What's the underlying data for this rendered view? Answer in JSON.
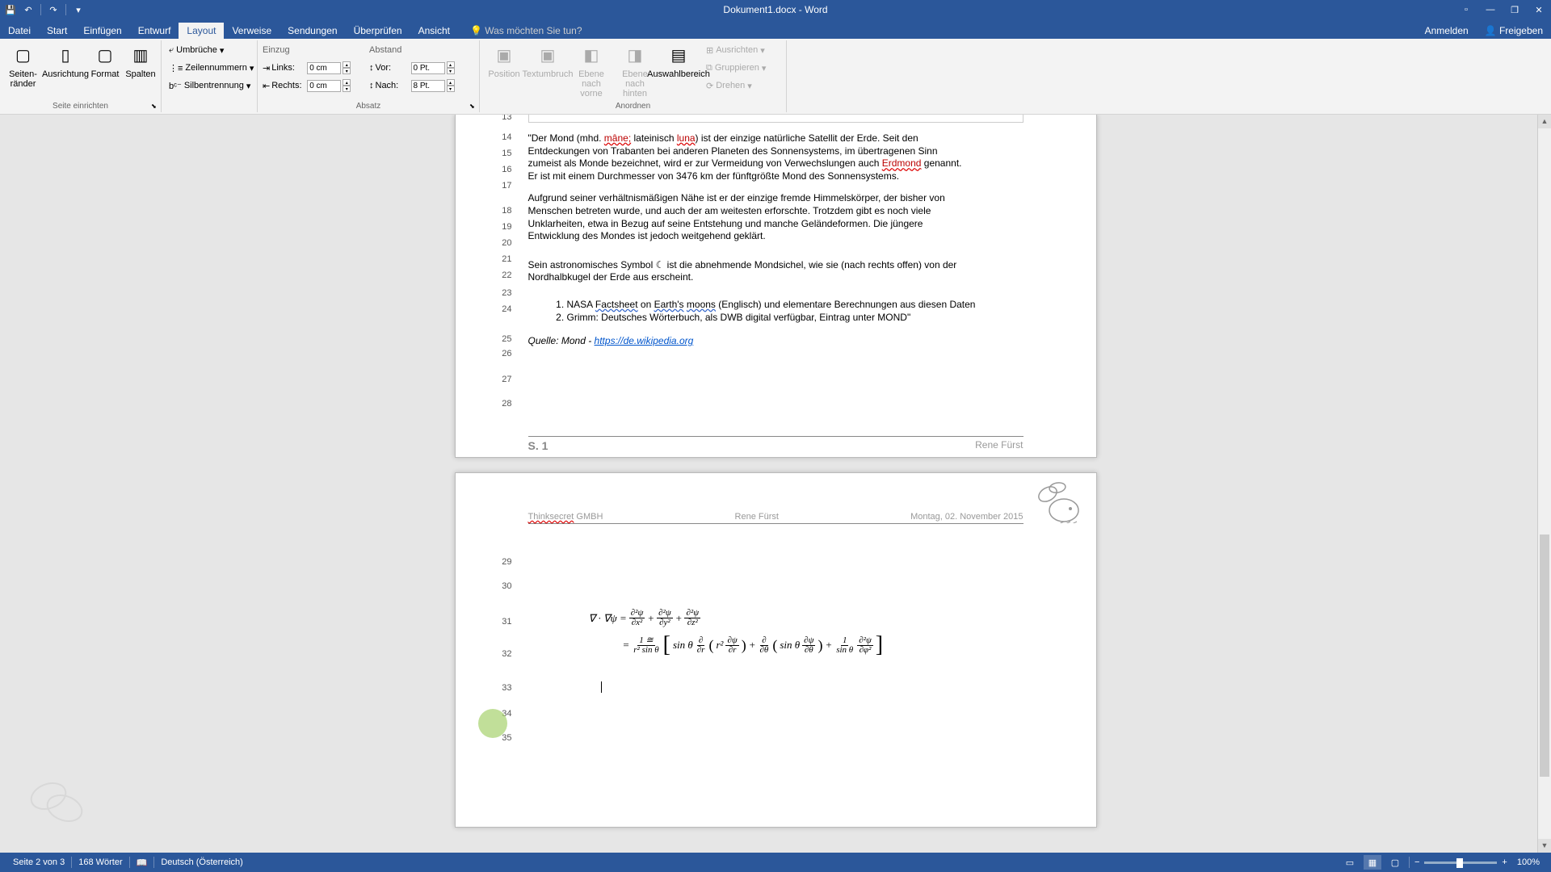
{
  "title": "Dokument1.docx - Word",
  "tabs": [
    "Datei",
    "Start",
    "Einfügen",
    "Entwurf",
    "Layout",
    "Verweise",
    "Sendungen",
    "Überprüfen",
    "Ansicht"
  ],
  "tellMe": "Was möchten Sie tun?",
  "tabRight": {
    "anmelden": "Anmelden",
    "freigeben": "Freigeben"
  },
  "ribbon": {
    "g1": {
      "seitenrander": "Seiten-\nränder",
      "ausrichtung": "Ausrichtung",
      "format": "Format",
      "spalten": "Spalten",
      "umbruche": "Umbrüche",
      "zeilennummern": "Zeilennummern",
      "silben": "Silbentrennung",
      "label": "Seite einrichten"
    },
    "g2": {
      "einzug": "Einzug",
      "links": "Links:",
      "links_v": "0 cm",
      "rechts": "Rechts:",
      "rechts_v": "0 cm",
      "abstand": "Abstand",
      "vor": "Vor:",
      "vor_v": "0 Pt.",
      "nach": "Nach:",
      "nach_v": "8 Pt.",
      "label": "Absatz"
    },
    "g3": {
      "position": "Position",
      "textumbruch": "Textumbruch",
      "ebenev": "Ebene nach\nvorne",
      "ebeneh": "Ebene nach\nhinten",
      "auswahl": "Auswahlbereich",
      "ausrichten": "Ausrichten",
      "gruppieren": "Gruppieren",
      "drehen": "Drehen",
      "label": "Anordnen"
    }
  },
  "doc": {
    "lines_p1": [
      "13",
      "14",
      "15",
      "16",
      "17",
      "18",
      "19",
      "20",
      "21",
      "22",
      "23",
      "24",
      "25",
      "26",
      "27",
      "28"
    ],
    "lines_p2": [
      "29",
      "30",
      "31",
      "32",
      "33",
      "34",
      "35"
    ],
    "l14a": "\"Der Mond (mhd. ",
    "l14b": "mâne;",
    "l14c": " lateinisch ",
    "l14d": "luna",
    "l14e": ") ist der einzige natürliche Satellit der Erde. Seit den",
    "l15": "Entdeckungen von Trabanten bei anderen Planeten des Sonnensystems, im übertragenen Sinn",
    "l16a": "zumeist als Monde bezeichnet, wird er zur Vermeidung von Verwechslungen auch ",
    "l16b": "Erdmond",
    "l16c": " genannt.",
    "l17": "Er ist mit einem Durchmesser von 3476 km der fünftgrößte Mond des Sonnensystems.",
    "l18": "Aufgrund seiner verhältnismäßigen Nähe ist er der einzige fremde Himmelskörper, der bisher von",
    "l19": "Menschen betreten wurde, und auch der am weitesten erforschte. Trotzdem gibt es noch viele",
    "l20": "Unklarheiten, etwa in Bezug auf seine Entstehung und manche Geländeformen. Die jüngere",
    "l21": "Entwicklung des Mondes ist jedoch weitgehend geklärt.",
    "l23": "Sein astronomisches Symbol ☾ ist die abnehmende Mondsichel, wie sie (nach rechts offen) von der",
    "l24": "Nordhalbkugel der Erde aus erscheint.",
    "l25a": "NASA ",
    "l25b": "Factsheet",
    "l25c": " on ",
    "l25d": "Earth's",
    "l25e": "moons",
    "l25f": " (Englisch) und elementare Berechnungen aus diesen Daten",
    "l26": "Grimm: Deutsches Wörterbuch, als DWB digital verfügbar, Eintrag unter MOND\"",
    "l27a": "Quelle: Mond - ",
    "l27b": "https://de.wikipedia.org",
    "pnum": "S. 1",
    "author": "Rene Fürst",
    "hdr_company": "Thinksecret",
    "hdr_company2": " GMBH",
    "hdr_author": "Rene Fürst",
    "hdr_date": "Montag, 02. November 2015"
  },
  "status": {
    "page": "Seite 2 von 3",
    "words": "168 Wörter",
    "lang": "Deutsch (Österreich)",
    "zoom": "100%"
  }
}
